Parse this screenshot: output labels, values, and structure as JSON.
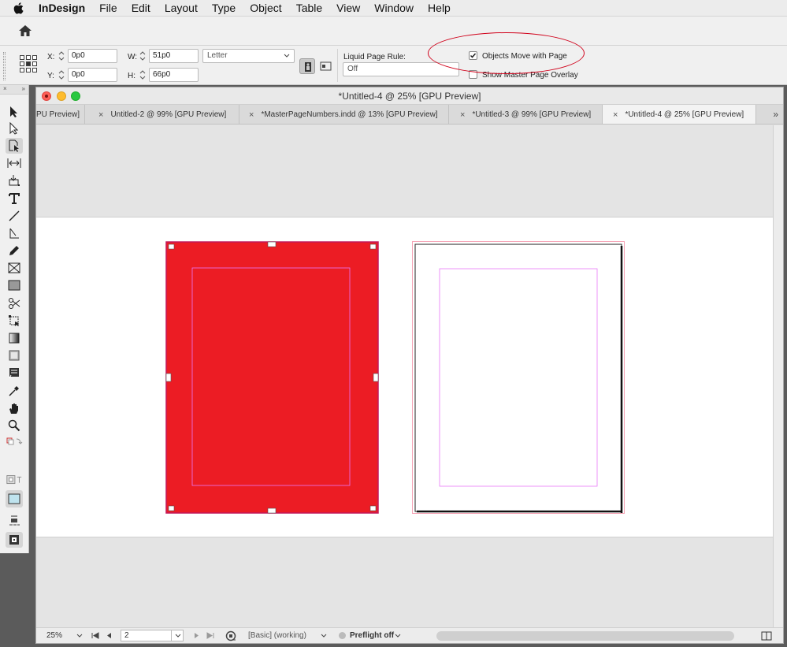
{
  "menubar": {
    "app": "InDesign",
    "items": [
      "File",
      "Edit",
      "Layout",
      "Type",
      "Object",
      "Table",
      "View",
      "Window",
      "Help"
    ]
  },
  "control": {
    "x_label": "X:",
    "x_value": "0p0",
    "y_label": "Y:",
    "y_value": "0p0",
    "w_label": "W:",
    "w_value": "51p0",
    "h_label": "H:",
    "h_value": "66p0",
    "page_size": "Letter",
    "liquid_label": "Liquid Page Rule:",
    "liquid_value": "Off",
    "objects_move_label": "Objects Move with Page",
    "objects_move_checked": true,
    "master_overlay_label": "Show Master Page Overlay",
    "master_overlay_checked": false,
    "annotation_color": "#d0021b"
  },
  "tools_panel": {
    "collapse": "×",
    "expand": "»"
  },
  "document": {
    "title": "*Untitled-4 @ 25% [GPU Preview]",
    "tabs": [
      {
        "label": "PU Preview]",
        "closable": false
      },
      {
        "label": "Untitled-2 @ 99% [GPU Preview]",
        "closable": true
      },
      {
        "label": "*MasterPageNumbers.indd @ 13% [GPU Preview]",
        "closable": true
      },
      {
        "label": "*Untitled-3 @ 99% [GPU Preview]",
        "closable": true
      },
      {
        "label": "*Untitled-4 @ 25% [GPU Preview]",
        "closable": true,
        "active": true
      }
    ],
    "tab_close": "×",
    "tabs_more": "»",
    "selected_frame_color": "#ec1c24",
    "margin_color": "#e879f9"
  },
  "statusbar": {
    "zoom": "25%",
    "page": "2",
    "style": "[Basic] (working)",
    "preflight": "Preflight off"
  }
}
